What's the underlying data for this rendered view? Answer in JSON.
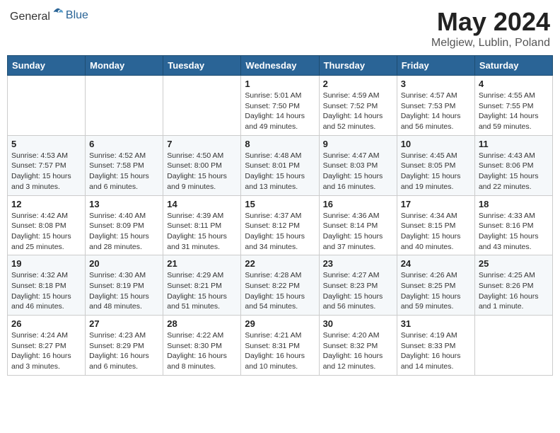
{
  "header": {
    "logo_general": "General",
    "logo_blue": "Blue",
    "month": "May 2024",
    "location": "Melgiew, Lublin, Poland"
  },
  "days_of_week": [
    "Sunday",
    "Monday",
    "Tuesday",
    "Wednesday",
    "Thursday",
    "Friday",
    "Saturday"
  ],
  "weeks": [
    [
      {
        "day": "",
        "info": ""
      },
      {
        "day": "",
        "info": ""
      },
      {
        "day": "",
        "info": ""
      },
      {
        "day": "1",
        "sunrise": "5:01 AM",
        "sunset": "7:50 PM",
        "daylight": "14 hours and 49 minutes."
      },
      {
        "day": "2",
        "sunrise": "4:59 AM",
        "sunset": "7:52 PM",
        "daylight": "14 hours and 52 minutes."
      },
      {
        "day": "3",
        "sunrise": "4:57 AM",
        "sunset": "7:53 PM",
        "daylight": "14 hours and 56 minutes."
      },
      {
        "day": "4",
        "sunrise": "4:55 AM",
        "sunset": "7:55 PM",
        "daylight": "14 hours and 59 minutes."
      }
    ],
    [
      {
        "day": "5",
        "sunrise": "4:53 AM",
        "sunset": "7:57 PM",
        "daylight": "15 hours and 3 minutes."
      },
      {
        "day": "6",
        "sunrise": "4:52 AM",
        "sunset": "7:58 PM",
        "daylight": "15 hours and 6 minutes."
      },
      {
        "day": "7",
        "sunrise": "4:50 AM",
        "sunset": "8:00 PM",
        "daylight": "15 hours and 9 minutes."
      },
      {
        "day": "8",
        "sunrise": "4:48 AM",
        "sunset": "8:01 PM",
        "daylight": "15 hours and 13 minutes."
      },
      {
        "day": "9",
        "sunrise": "4:47 AM",
        "sunset": "8:03 PM",
        "daylight": "15 hours and 16 minutes."
      },
      {
        "day": "10",
        "sunrise": "4:45 AM",
        "sunset": "8:05 PM",
        "daylight": "15 hours and 19 minutes."
      },
      {
        "day": "11",
        "sunrise": "4:43 AM",
        "sunset": "8:06 PM",
        "daylight": "15 hours and 22 minutes."
      }
    ],
    [
      {
        "day": "12",
        "sunrise": "4:42 AM",
        "sunset": "8:08 PM",
        "daylight": "15 hours and 25 minutes."
      },
      {
        "day": "13",
        "sunrise": "4:40 AM",
        "sunset": "8:09 PM",
        "daylight": "15 hours and 28 minutes."
      },
      {
        "day": "14",
        "sunrise": "4:39 AM",
        "sunset": "8:11 PM",
        "daylight": "15 hours and 31 minutes."
      },
      {
        "day": "15",
        "sunrise": "4:37 AM",
        "sunset": "8:12 PM",
        "daylight": "15 hours and 34 minutes."
      },
      {
        "day": "16",
        "sunrise": "4:36 AM",
        "sunset": "8:14 PM",
        "daylight": "15 hours and 37 minutes."
      },
      {
        "day": "17",
        "sunrise": "4:34 AM",
        "sunset": "8:15 PM",
        "daylight": "15 hours and 40 minutes."
      },
      {
        "day": "18",
        "sunrise": "4:33 AM",
        "sunset": "8:16 PM",
        "daylight": "15 hours and 43 minutes."
      }
    ],
    [
      {
        "day": "19",
        "sunrise": "4:32 AM",
        "sunset": "8:18 PM",
        "daylight": "15 hours and 46 minutes."
      },
      {
        "day": "20",
        "sunrise": "4:30 AM",
        "sunset": "8:19 PM",
        "daylight": "15 hours and 48 minutes."
      },
      {
        "day": "21",
        "sunrise": "4:29 AM",
        "sunset": "8:21 PM",
        "daylight": "15 hours and 51 minutes."
      },
      {
        "day": "22",
        "sunrise": "4:28 AM",
        "sunset": "8:22 PM",
        "daylight": "15 hours and 54 minutes."
      },
      {
        "day": "23",
        "sunrise": "4:27 AM",
        "sunset": "8:23 PM",
        "daylight": "15 hours and 56 minutes."
      },
      {
        "day": "24",
        "sunrise": "4:26 AM",
        "sunset": "8:25 PM",
        "daylight": "15 hours and 59 minutes."
      },
      {
        "day": "25",
        "sunrise": "4:25 AM",
        "sunset": "8:26 PM",
        "daylight": "16 hours and 1 minute."
      }
    ],
    [
      {
        "day": "26",
        "sunrise": "4:24 AM",
        "sunset": "8:27 PM",
        "daylight": "16 hours and 3 minutes."
      },
      {
        "day": "27",
        "sunrise": "4:23 AM",
        "sunset": "8:29 PM",
        "daylight": "16 hours and 6 minutes."
      },
      {
        "day": "28",
        "sunrise": "4:22 AM",
        "sunset": "8:30 PM",
        "daylight": "16 hours and 8 minutes."
      },
      {
        "day": "29",
        "sunrise": "4:21 AM",
        "sunset": "8:31 PM",
        "daylight": "16 hours and 10 minutes."
      },
      {
        "day": "30",
        "sunrise": "4:20 AM",
        "sunset": "8:32 PM",
        "daylight": "16 hours and 12 minutes."
      },
      {
        "day": "31",
        "sunrise": "4:19 AM",
        "sunset": "8:33 PM",
        "daylight": "16 hours and 14 minutes."
      },
      {
        "day": "",
        "info": ""
      }
    ]
  ]
}
